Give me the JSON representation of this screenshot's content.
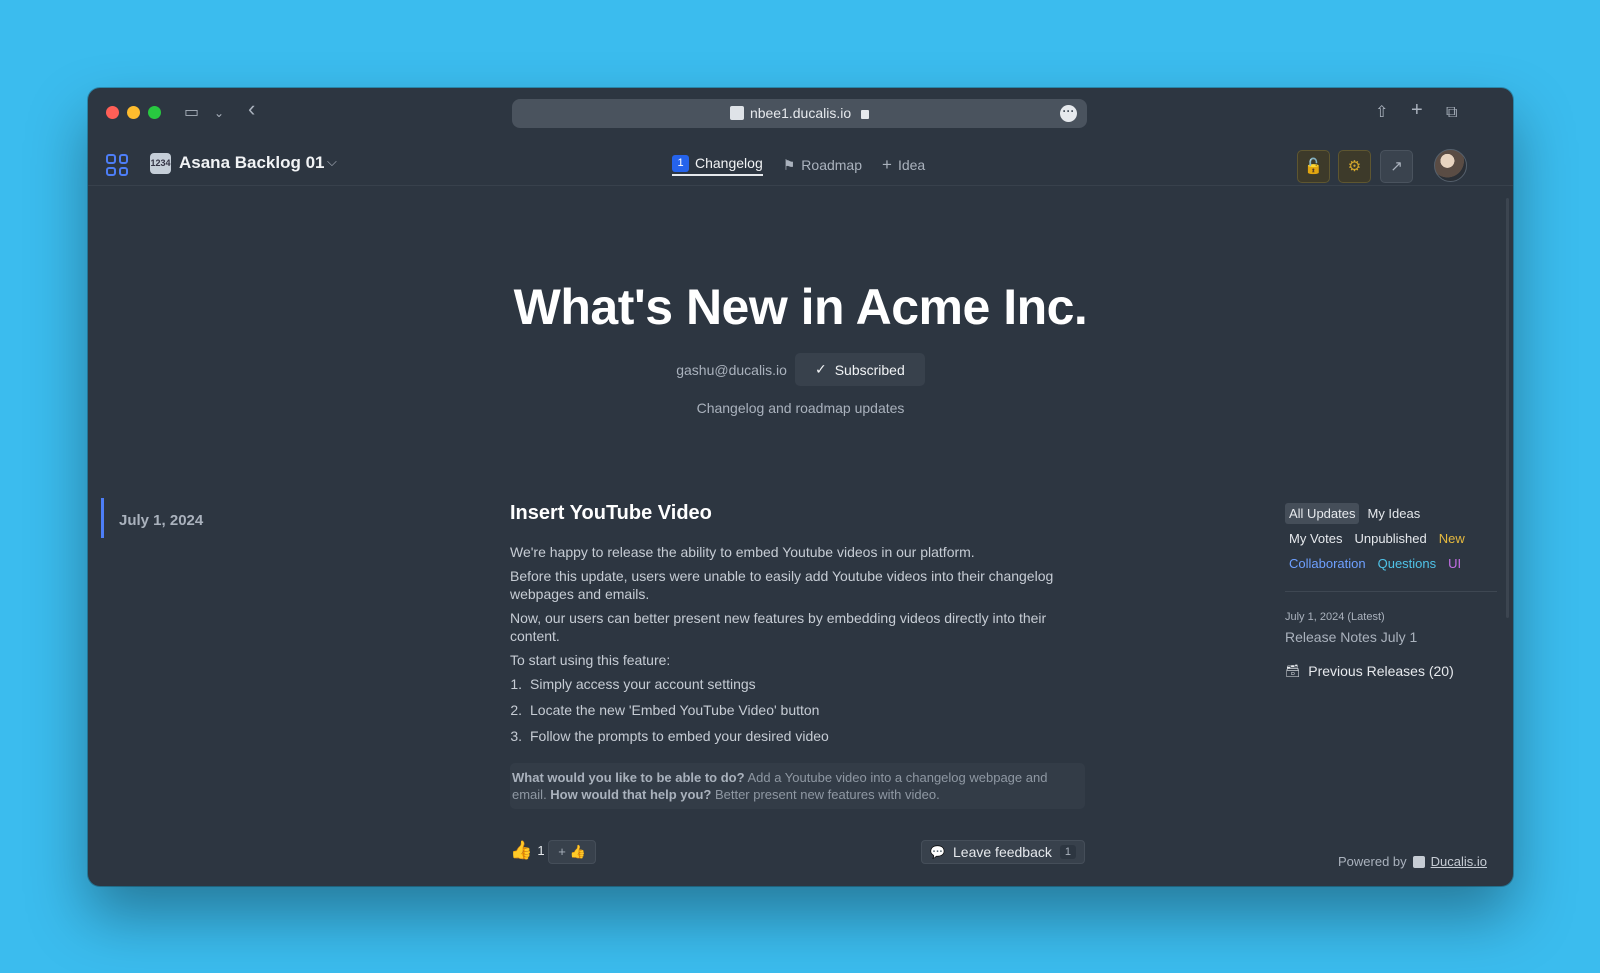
{
  "browser": {
    "url": "nbee1.ducalis.io",
    "back_glyph": "‹",
    "sidebar_glyph": "▭",
    "caret_glyph": "⌄",
    "more_glyph": "···",
    "share_glyph": "⇧",
    "newtab_glyph": "+",
    "tabs_glyph": "⧉"
  },
  "appbar": {
    "board_icon_text": "1234",
    "board_name": "Asana Backlog 01",
    "board_caret": "⌵",
    "nav": [
      {
        "label": "Changelog",
        "badge": "1",
        "active": true
      },
      {
        "label": "Roadmap",
        "icon": "roadmap-icon",
        "active": false
      },
      {
        "label": "Idea",
        "icon": "plus-icon",
        "active": false
      }
    ],
    "roadmap_glyph": "⚑",
    "idea_glyph": "+",
    "lock_glyph": "🔓",
    "gear_glyph": "⚙",
    "external_glyph": "↗"
  },
  "hero": {
    "title": "What's New in Acme Inc.",
    "email": "gashu@ducalis.io",
    "subscribed_label": "Subscribed",
    "check_glyph": "✓",
    "description": "Changelog and roadmap updates"
  },
  "date": "July 1, 2024",
  "post": {
    "title": "Insert YouTube Video",
    "paragraphs": [
      "We're happy to release the ability to embed Youtube videos in our platform.",
      "Before this update, users were unable to easily add Youtube videos into their changelog webpages and emails.",
      "Now, our users can better present new features by embedding videos directly into their content.",
      "To start using this feature:"
    ],
    "steps": [
      {
        "n": "1.",
        "text": "Simply access your account settings"
      },
      {
        "n": "2.",
        "text": "Locate the new 'Embed YouTube Video' button"
      },
      {
        "n": "3.",
        "text": "Follow the prompts to embed your desired video"
      }
    ],
    "q1": "What would you like to be able to do?",
    "a1": " Add a Youtube video into a changelog webpage and email. ",
    "q2": "How would that help you?",
    "a2": " Better present new features with video.",
    "reaction_glyph": "👍",
    "reaction_count": "1",
    "add_reaction_glyph": "+ 👍",
    "feedback_glyph": "💬",
    "feedback_label": "Leave feedback",
    "feedback_count": "1"
  },
  "filters": {
    "all_updates": "All Updates",
    "my_ideas": "My Ideas",
    "my_votes": "My Votes",
    "unpublished": "Unpublished",
    "new": "New",
    "collaboration": "Collaboration",
    "questions": "Questions",
    "ui": "UI"
  },
  "sidebar": {
    "latest_date": "July 1, 2024 (Latest)",
    "latest_title": "Release Notes July 1",
    "archive_glyph": "🗃",
    "previous_releases": "Previous Releases (20)"
  },
  "footer": {
    "powered_by": "Powered by",
    "brand": "Ducalis.io"
  },
  "colors": {
    "accent": "#4d7ef7",
    "background": "#3bbcee",
    "window": "#2d3641",
    "new": "#e5b93f",
    "collaboration": "#6ea0ff",
    "questions": "#4fc3e8",
    "ui": "#c46fe6"
  }
}
